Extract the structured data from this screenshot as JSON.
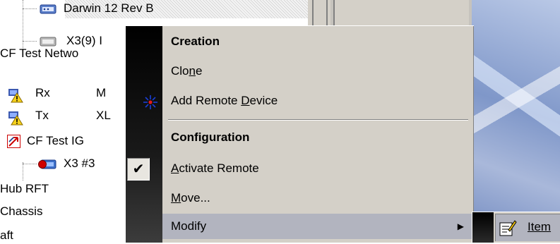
{
  "tree": {
    "rows": [
      {
        "label": "Darwin 12 Rev B",
        "icon": "device-icon"
      },
      {
        "label": "X3(9) I",
        "icon": "device-gray-icon"
      },
      {
        "label": "CF Test Netwo",
        "icon": ""
      },
      {
        "label": "Rx",
        "extra": "M",
        "icon": "warning-device-icon"
      },
      {
        "label": "Tx",
        "extra": "XL",
        "icon": "warning-device-icon"
      },
      {
        "label": "CF Test IG",
        "icon": "red-arrows-icon"
      },
      {
        "label": "X3 #3",
        "icon": "device-red-icon"
      },
      {
        "label": "Hub RFT",
        "icon": ""
      },
      {
        "label": "Chassis",
        "icon": ""
      },
      {
        "label": "aft",
        "icon": ""
      }
    ]
  },
  "menu": {
    "creation_header": "Creation",
    "clone": {
      "pre": "Clo",
      "accel": "n",
      "post": "e"
    },
    "add_remote_device": {
      "pre": "Add Remote ",
      "accel": "D",
      "post": "evice",
      "icon": "sparkle-icon"
    },
    "configuration_header": "Configuration",
    "activate_remote": {
      "pre": "",
      "accel": "A",
      "post": "ctivate Remote",
      "checked": true
    },
    "move": {
      "pre": "",
      "accel": "M",
      "post": "ove..."
    },
    "modify": {
      "label": "Modify",
      "submenu_arrow": "▶"
    }
  },
  "submenu": {
    "item_label": "Item",
    "item_icon": "edit-document-icon"
  },
  "colors": {
    "menu_bg": "#d4d0c8",
    "menu_band": "#000000",
    "selection": "#b2b4bf",
    "desktop": "#7f97c9"
  }
}
